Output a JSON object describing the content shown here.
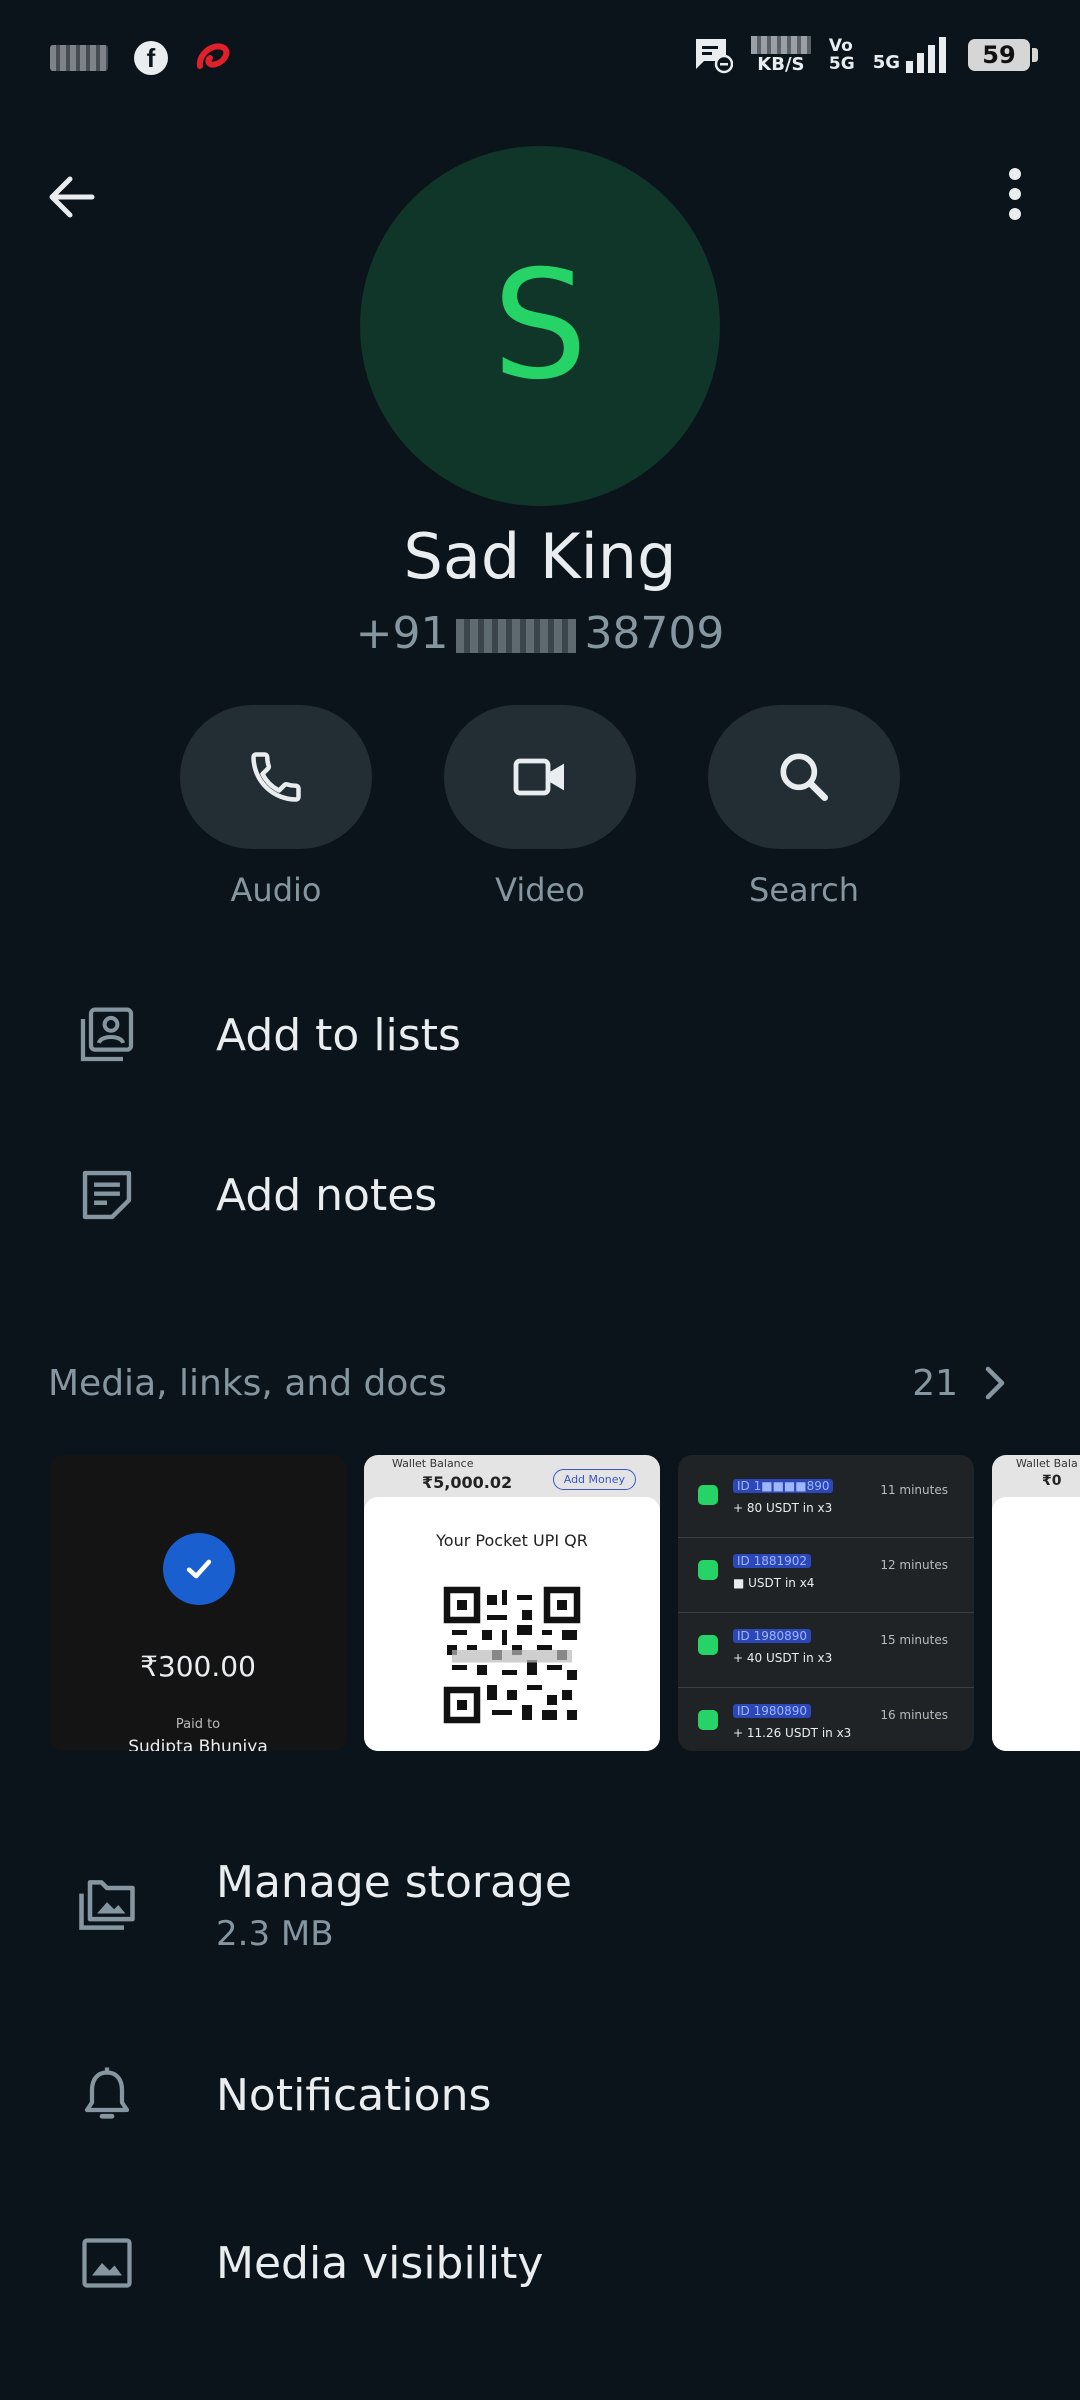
{
  "status_bar": {
    "speed_unit": "KB/S",
    "volte": [
      "Vo",
      "5G"
    ],
    "network": "5G",
    "battery": "59"
  },
  "contact": {
    "avatar_letter": "S",
    "name": "Sad King",
    "phone_prefix": "+91",
    "phone_suffix": "38709"
  },
  "actions": [
    {
      "label": "Audio",
      "icon": "phone-icon"
    },
    {
      "label": "Video",
      "icon": "video-icon"
    },
    {
      "label": "Search",
      "icon": "search-icon"
    }
  ],
  "rows_top": [
    {
      "label": "Add to lists",
      "icon": "lists-icon"
    },
    {
      "label": "Add notes",
      "icon": "notes-icon"
    }
  ],
  "media": {
    "title": "Media, links, and docs",
    "count": "21",
    "thumb1": {
      "amount": "₹300.00",
      "paid_to": "Paid to",
      "name": "Sudipta Bhuniya"
    },
    "thumb2": {
      "wallet_label": "Wallet Balance",
      "wallet_amount": "₹5,000.02",
      "wallet_button": "Add Money",
      "qr_title": "Your Pocket UPI QR"
    },
    "thumb3": {
      "rows": [
        {
          "id": "ID 1■■■■890",
          "amount": "+ 80 USDT in x3",
          "time": "11 minutes"
        },
        {
          "id": "ID 1881902",
          "amount": "■ USDT in x4",
          "time": "12 minutes"
        },
        {
          "id": "ID 1980890",
          "amount": "+ 40 USDT in x3",
          "time": "15 minutes"
        },
        {
          "id": "ID 1980890",
          "amount": "+ 11.26 USDT in x3",
          "time": "16 minutes"
        }
      ]
    },
    "thumb4": {
      "wallet_label": "Wallet Bala",
      "wallet_amount": "₹0"
    }
  },
  "storage": {
    "label": "Manage storage",
    "size": "2.3 MB"
  },
  "rows_bottom": [
    {
      "label": "Notifications",
      "icon": "bell-icon"
    },
    {
      "label": "Media visibility",
      "icon": "image-icon"
    }
  ],
  "colors": {
    "background": "#0b141a",
    "accent": "#25d366",
    "avatar_bg": "#103529",
    "pill": "#222d34",
    "muted": "#8696a0"
  }
}
